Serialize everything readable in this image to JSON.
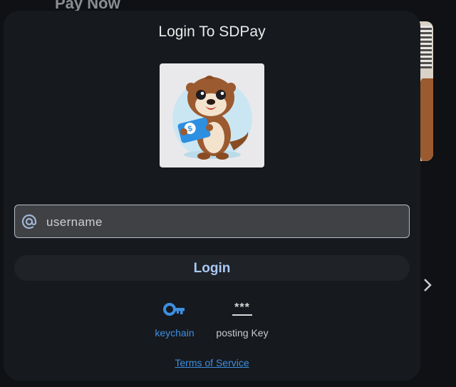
{
  "background": {
    "title": "Pay Now"
  },
  "modal": {
    "title": "Login To SDPay",
    "logo_alt": "SDPay otter mascot"
  },
  "login_form": {
    "username_placeholder": "username",
    "login_label": "Login"
  },
  "auth_methods": [
    {
      "label": "keychain",
      "icon": "key-icon",
      "selected": true
    },
    {
      "label": "posting Key",
      "icon": "asterisk-password-icon",
      "selected": false
    }
  ],
  "footer": {
    "terms_label": "Terms of Service"
  },
  "colors": {
    "accent": "#3d8fe0",
    "login_text": "#a9c9f5",
    "modal_bg": "#16191e",
    "input_bg": "#404144"
  }
}
